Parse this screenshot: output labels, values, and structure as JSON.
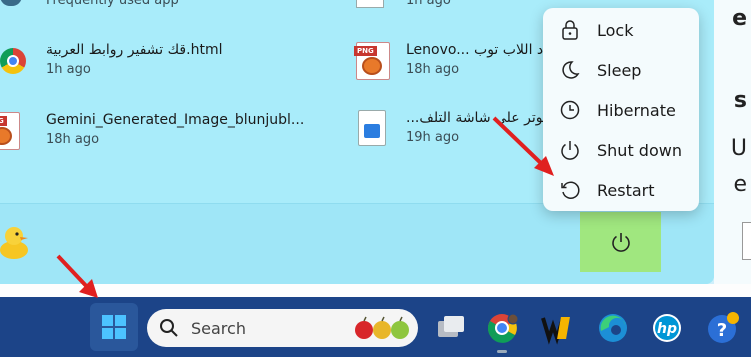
{
  "recent": {
    "top_left_fade": "Frequently used app",
    "top_right_fade": "1h ago",
    "items": [
      {
        "name": "قك تشفير روابط العربية.html",
        "time": "1h ago"
      },
      {
        "name": "Lenovo... بـ د اللاب توب",
        "time": "18h ago"
      },
      {
        "name": "Gemini_Generated_Image_blunjubl...",
        "time": "18h ago"
      },
      {
        "name": "...يوتر على شاشة التلف",
        "time": "19h ago"
      }
    ]
  },
  "png_tag": "PNG",
  "power_menu": {
    "items": [
      {
        "label": "Lock",
        "icon": "lock-icon"
      },
      {
        "label": "Sleep",
        "icon": "moon-icon"
      },
      {
        "label": "Hibernate",
        "icon": "clock-icon"
      },
      {
        "label": "Shut down",
        "icon": "power-icon"
      },
      {
        "label": "Restart",
        "icon": "restart-icon"
      }
    ]
  },
  "right_strip": {
    "chars": [
      "e",
      "s",
      "U",
      "e"
    ]
  },
  "taskbar": {
    "search_label": "Search",
    "accent": "#1c4488"
  },
  "colors": {
    "panel": "#a9ecfa",
    "power_button": "#a0e77f",
    "arrow": "#e02020"
  }
}
